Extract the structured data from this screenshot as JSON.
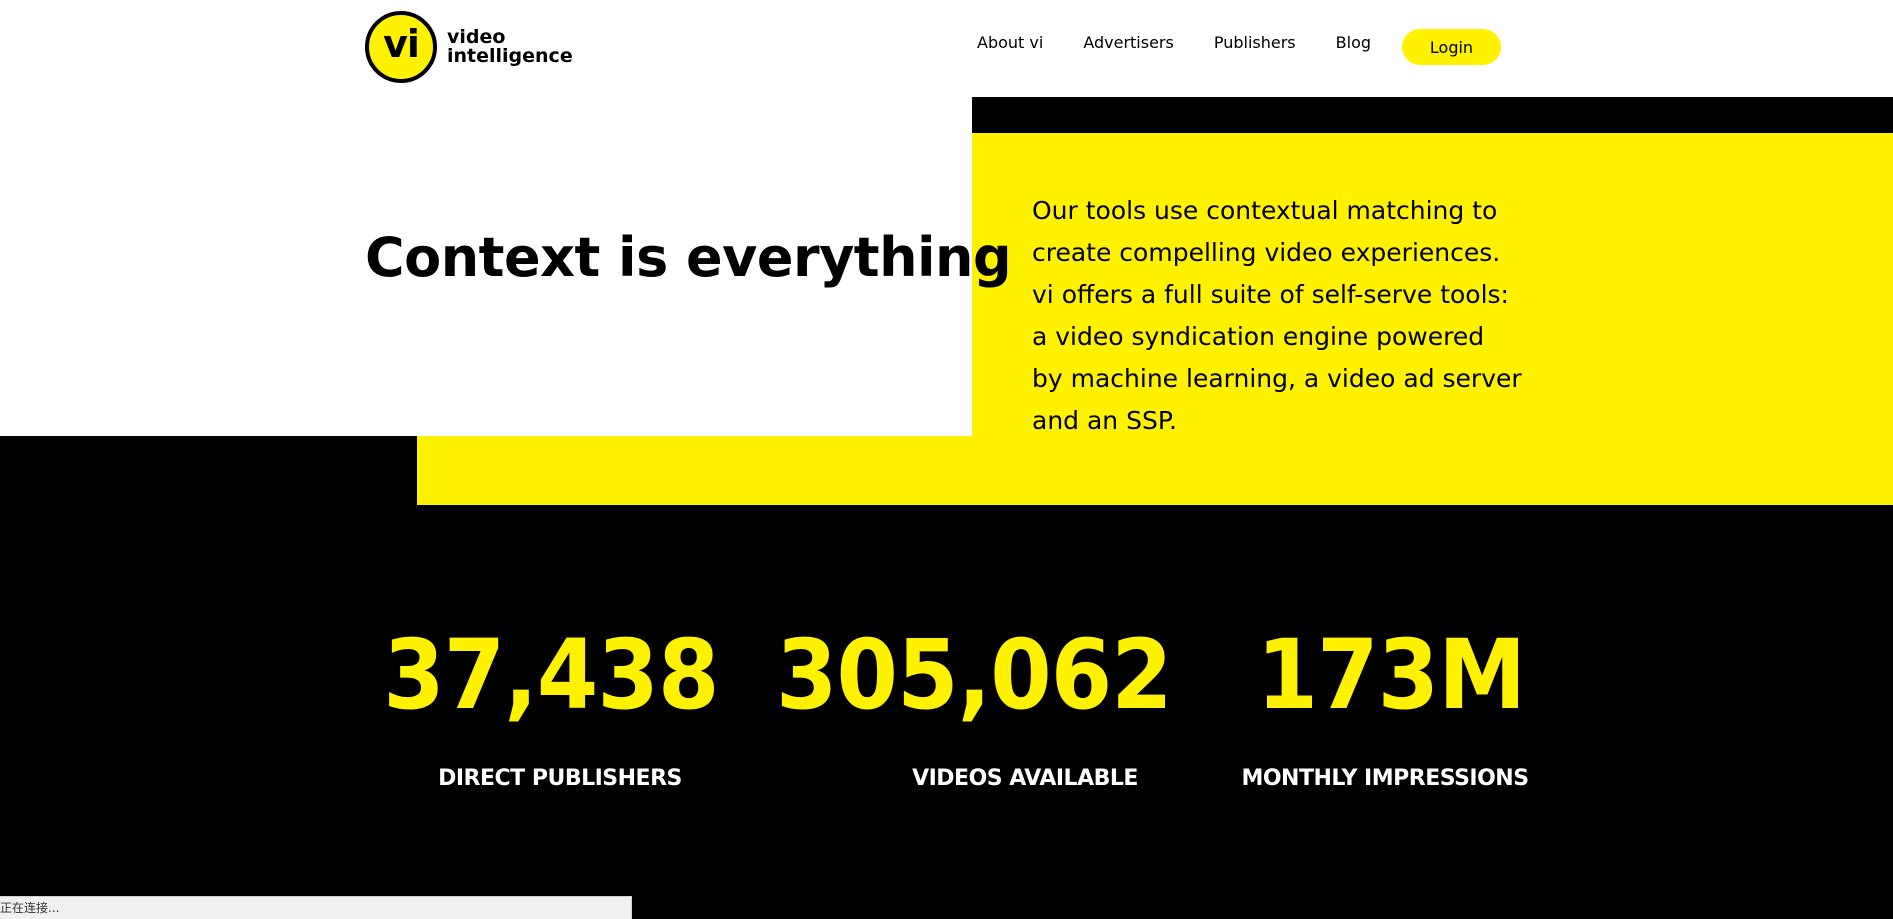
{
  "header": {
    "logo": {
      "mark": "vi",
      "line1": "video",
      "line2": "intelligence"
    },
    "nav": [
      {
        "label": "About vi"
      },
      {
        "label": "Advertisers"
      },
      {
        "label": "Publishers"
      },
      {
        "label": "Blog"
      }
    ],
    "login_label": "Login"
  },
  "hero": {
    "title": "Context is everything",
    "description": "Our tools use contextual matching to create compelling video experiences. vi offers a full suite of self-serve tools: a video syndication engine powered by machine learning, a video ad server and an SSP."
  },
  "stats": [
    {
      "value": "37,438",
      "label": "DIRECT PUBLISHERS"
    },
    {
      "value": "305,062",
      "label": "VIDEOS AVAILABLE"
    },
    {
      "value": "173M",
      "label": "MONTHLY IMPRESSIONS"
    }
  ],
  "status_bar": {
    "text": "正在连接..."
  },
  "colors": {
    "brand_yellow": "#fff200",
    "black": "#000000",
    "white": "#ffffff"
  }
}
